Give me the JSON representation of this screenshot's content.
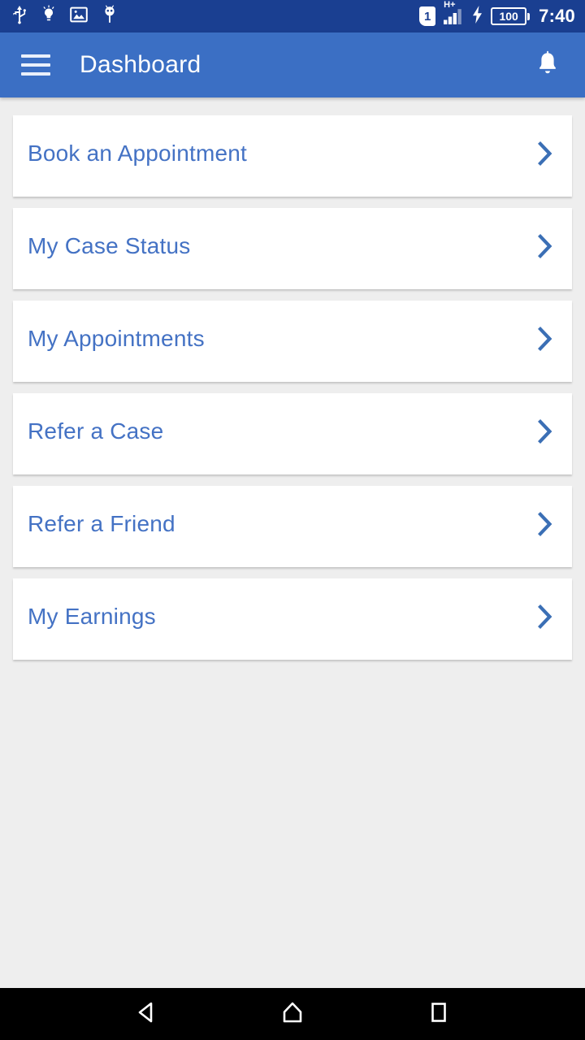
{
  "status_bar": {
    "background_color": "#1a3f91",
    "left_icons": [
      {
        "name": "usb-icon",
        "label": "USB"
      },
      {
        "name": "bug-report-icon",
        "label": "Bug report"
      },
      {
        "name": "screenshot-image-icon",
        "label": "Screenshot"
      },
      {
        "name": "android-debug-icon",
        "label": "Android debug"
      }
    ],
    "sim_label": "1",
    "network_type": "H+",
    "signal_bars": 4,
    "charging": true,
    "battery_level": "100",
    "time": "7:40"
  },
  "app_bar": {
    "background_color": "#3b6fc4",
    "menu_icon": "hamburger-menu-icon",
    "title": "Dashboard",
    "notification_icon": "bell-icon"
  },
  "main": {
    "background_color": "#eeeeee",
    "accent_color": "#4472c4",
    "cards": [
      {
        "label": "Book an Appointment",
        "name": "book-an-appointment"
      },
      {
        "label": "My Case Status",
        "name": "my-case-status"
      },
      {
        "label": "My Appointments",
        "name": "my-appointments"
      },
      {
        "label": "Refer a Case",
        "name": "refer-a-case"
      },
      {
        "label": "Refer a Friend",
        "name": "refer-a-friend"
      },
      {
        "label": "My Earnings",
        "name": "my-earnings"
      }
    ]
  },
  "nav_bar": {
    "background_color": "#000000",
    "buttons": [
      {
        "name": "back-button",
        "label": "Back"
      },
      {
        "name": "home-button",
        "label": "Home"
      },
      {
        "name": "recents-button",
        "label": "Recents"
      }
    ]
  }
}
